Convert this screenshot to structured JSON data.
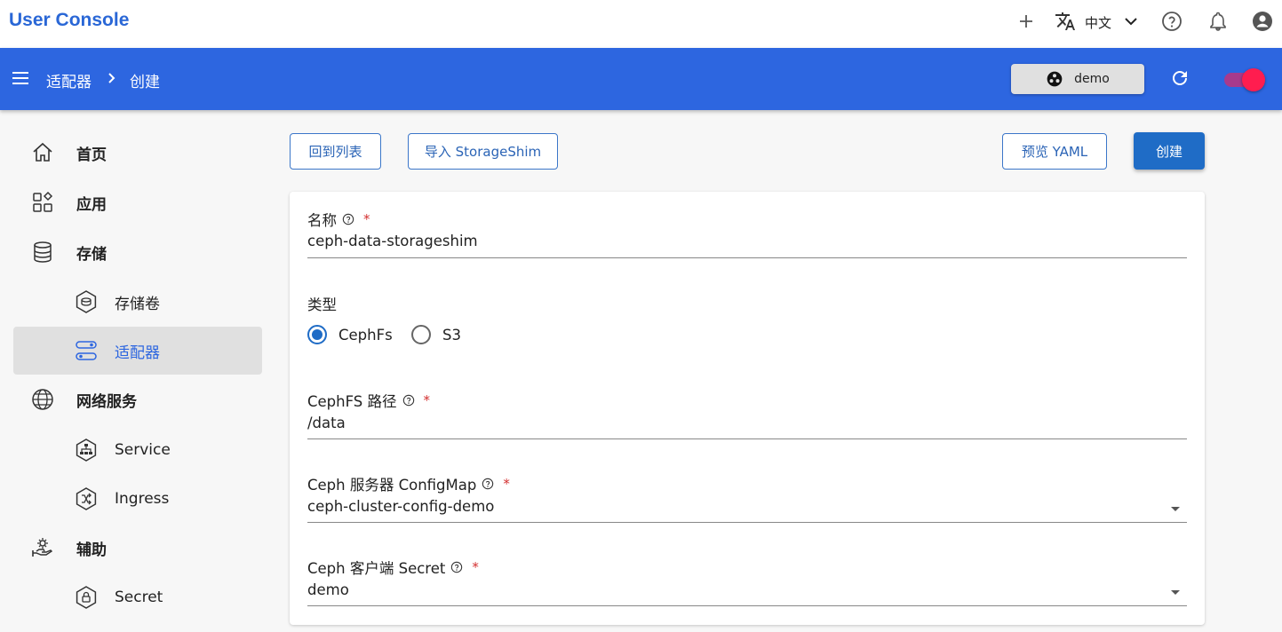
{
  "app": {
    "title": "User Console",
    "accent": "#2d66e0"
  },
  "topbar": {
    "language": "中文"
  },
  "header": {
    "breadcrumb": [
      "适配器",
      "创建"
    ],
    "namespace": "demo"
  },
  "sidebar": {
    "items": [
      {
        "label": "首页",
        "icon": "home-icon"
      },
      {
        "label": "应用",
        "icon": "apps-icon"
      },
      {
        "label": "存储",
        "icon": "database-icon"
      },
      {
        "label": "存储卷",
        "icon": "volume-icon"
      },
      {
        "label": "适配器",
        "icon": "adapter-icon"
      },
      {
        "label": "网络服务",
        "icon": "globe-icon"
      },
      {
        "label": "Service",
        "icon": "service-icon"
      },
      {
        "label": "Ingress",
        "icon": "ingress-icon"
      },
      {
        "label": "辅助",
        "icon": "helper-icon"
      },
      {
        "label": "Secret",
        "icon": "lock-icon"
      }
    ]
  },
  "toolbar": {
    "back": "回到列表",
    "import": "导入 StorageShim",
    "preview": "预览 YAML",
    "create": "创建"
  },
  "form": {
    "name": {
      "label": "名称",
      "value": "ceph-data-storageshim"
    },
    "type": {
      "label": "类型",
      "options": [
        "CephFs",
        "S3"
      ],
      "selected": "CephFs"
    },
    "path": {
      "label": "CephFS 路径",
      "value": "/data"
    },
    "configmap": {
      "label": "Ceph 服务器 ConfigMap",
      "value": "ceph-cluster-config-demo"
    },
    "secret": {
      "label": "Ceph 客户端 Secret",
      "value": "demo"
    },
    "required_mark": "*"
  }
}
